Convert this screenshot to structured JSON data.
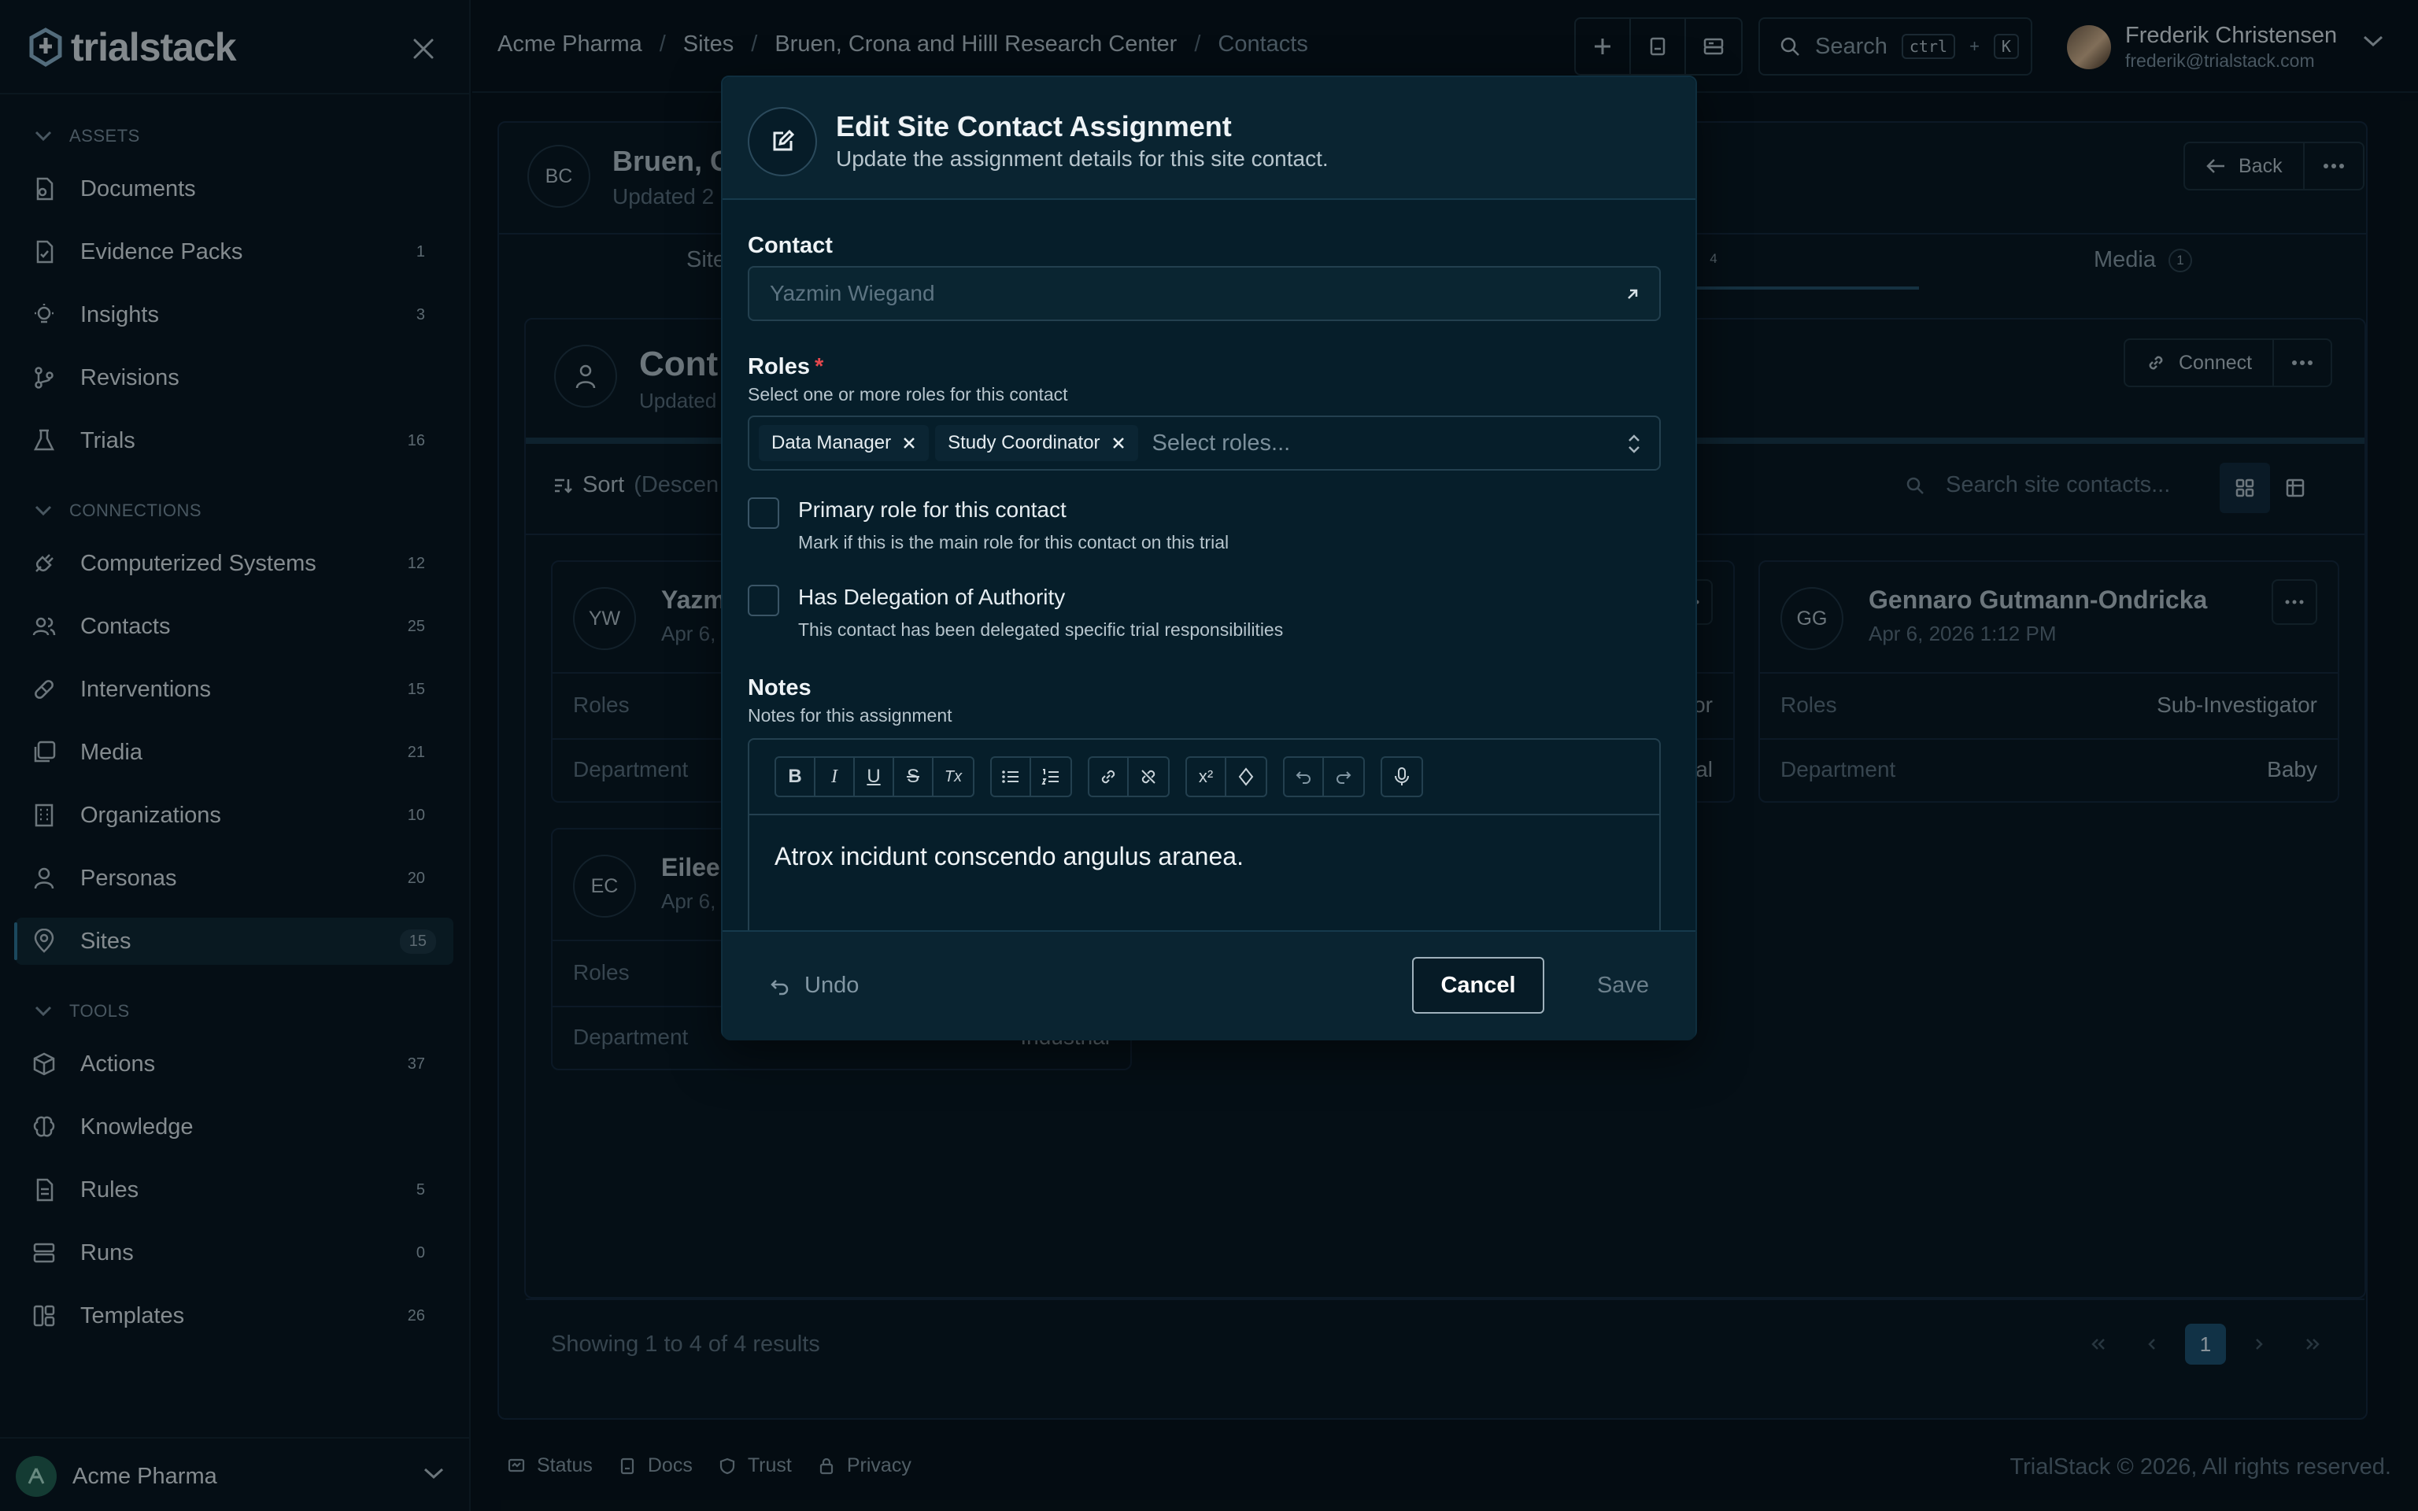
{
  "brand": {
    "name": "trialstack"
  },
  "sidebar": {
    "sections": [
      {
        "label": "ASSETS"
      },
      {
        "label": "CONNECTIONS"
      },
      {
        "label": "TOOLS"
      }
    ],
    "items": [
      {
        "label": "Documents",
        "count": "",
        "icon": "document-icon"
      },
      {
        "label": "Evidence Packs",
        "count": "1",
        "icon": "evidence-pack-icon"
      },
      {
        "label": "Insights",
        "count": "3",
        "icon": "lightbulb-icon"
      },
      {
        "label": "Revisions",
        "count": "",
        "icon": "git-branch-icon"
      },
      {
        "label": "Trials",
        "count": "16",
        "icon": "flask-icon"
      },
      {
        "label": "Computerized Systems",
        "count": "12",
        "icon": "plug-icon"
      },
      {
        "label": "Contacts",
        "count": "25",
        "icon": "users-icon"
      },
      {
        "label": "Interventions",
        "count": "15",
        "icon": "pill-icon"
      },
      {
        "label": "Media",
        "count": "21",
        "icon": "images-icon"
      },
      {
        "label": "Organizations",
        "count": "10",
        "icon": "building-icon"
      },
      {
        "label": "Personas",
        "count": "20",
        "icon": "person-icon"
      },
      {
        "label": "Sites",
        "count": "15",
        "icon": "map-pin-icon"
      },
      {
        "label": "Actions",
        "count": "37",
        "icon": "box-icon"
      },
      {
        "label": "Knowledge",
        "count": "",
        "icon": "brain-icon"
      },
      {
        "label": "Rules",
        "count": "5",
        "icon": "rules-icon"
      },
      {
        "label": "Runs",
        "count": "0",
        "icon": "server-icon"
      },
      {
        "label": "Templates",
        "count": "26",
        "icon": "template-icon"
      }
    ],
    "org": "Acme Pharma"
  },
  "breadcrumb": [
    "Acme Pharma",
    "Sites",
    "Bruen, Crona and Hilll Research Center",
    "Contacts"
  ],
  "search": {
    "placeholder": "Search",
    "kbd1": "ctrl",
    "plus": "+",
    "kbd2": "K"
  },
  "user": {
    "name": "Frederik Christensen",
    "email": "frederik@trialstack.com"
  },
  "site": {
    "initials": "BC",
    "title": "Bruen, C",
    "updated": "Updated 2",
    "back": "Back"
  },
  "tabs": [
    {
      "label": "Site",
      "badge": ""
    },
    {
      "label": "",
      "badge": "4"
    },
    {
      "label": "Media",
      "badge": "1"
    }
  ],
  "contacts_panel": {
    "title": "Cont",
    "updated": "Updated",
    "connect": "Connect",
    "sort": "Sort",
    "sort_dir": "(Descen",
    "search_placeholder": "Search site contacts..."
  },
  "contact_cards": [
    {
      "initials": "YW",
      "name": "Yazm",
      "date": "Apr 6,",
      "roles_label": "Roles",
      "roles": "",
      "dept_label": "Department",
      "dept": ""
    },
    {
      "initials": "",
      "name": "",
      "date": "",
      "roles_label": "",
      "roles": "or",
      "dept_label": "",
      "dept": "al"
    },
    {
      "initials": "GG",
      "name": "Gennaro Gutmann-Ondricka",
      "date": "Apr 6, 2026 1:12 PM",
      "roles_label": "Roles",
      "roles": "Sub-Investigator",
      "dept_label": "Department",
      "dept": "Baby"
    },
    {
      "initials": "EC",
      "name": "Eileer",
      "date": "Apr 6,",
      "roles_label": "Roles",
      "roles": "",
      "dept_label": "Department",
      "dept": "Industrial"
    }
  ],
  "results": {
    "text": "Showing 1 to 4 of 4 results",
    "page": "1"
  },
  "footer": {
    "links": [
      "Status",
      "Docs",
      "Trust",
      "Privacy"
    ],
    "copyright": "TrialStack © 2026, All rights reserved."
  },
  "modal": {
    "title": "Edit Site Contact Assignment",
    "subtitle": "Update the assignment details for this site contact.",
    "contact_label": "Contact",
    "contact_value": "Yazmin Wiegand",
    "roles_label": "Roles",
    "roles_required": "*",
    "roles_help": "Select one or more roles for this contact",
    "roles_selected": [
      "Data Manager",
      "Study Coordinator"
    ],
    "roles_placeholder": "Select roles...",
    "primary_label": "Primary role for this contact",
    "primary_help": "Mark if this is the main role for this contact on this trial",
    "primary_checked": false,
    "delegation_label": "Has Delegation of Authority",
    "delegation_help": "This contact has been delegated specific trial responsibilities",
    "delegation_checked": false,
    "notes_label": "Notes",
    "notes_help": "Notes for this assignment",
    "notes_value": "Atrox incidunt conscendo angulus aranea.",
    "toolbar": {
      "bold": "B",
      "italic": "I",
      "underline": "U",
      "strike": "S",
      "clear": "Tx",
      "superscript": "x²"
    },
    "undo": "Undo",
    "cancel": "Cancel",
    "save": "Save"
  }
}
